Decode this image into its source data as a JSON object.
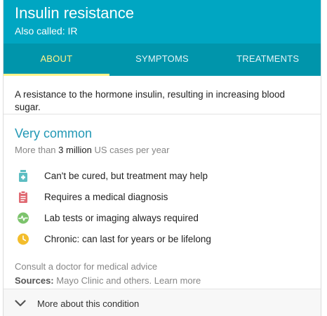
{
  "header": {
    "title": "Insulin resistance",
    "also_called": "Also called: IR"
  },
  "tabs": [
    {
      "label": "ABOUT",
      "active": true
    },
    {
      "label": "SYMPTOMS",
      "active": false
    },
    {
      "label": "TREATMENTS",
      "active": false
    }
  ],
  "description": "A resistance to the hormone insulin, resulting in increasing blood sugar.",
  "prevalence": {
    "heading": "Very common",
    "cases_prefix": "More than",
    "cases_count": "3 million",
    "cases_suffix": "US cases per year"
  },
  "facts": [
    {
      "icon": "medicine-bottle-icon",
      "color": "#5dbdc2",
      "text": "Can't be cured, but treatment may help"
    },
    {
      "icon": "clipboard-icon",
      "color": "#e06a73",
      "text": "Requires a medical diagnosis"
    },
    {
      "icon": "heartbeat-icon",
      "color": "#7cc36c",
      "text": "Lab tests or imaging always required"
    },
    {
      "icon": "clock-icon",
      "color": "#f3bd2c",
      "text": "Chronic: can last for years or be lifelong"
    }
  ],
  "consult": "Consult a doctor for medical advice",
  "sources": {
    "label": "Sources:",
    "text": "Mayo Clinic and others.",
    "link": "Learn more"
  },
  "more": {
    "label": "More about this condition"
  },
  "colors": {
    "header_bg": "#00a6c2",
    "tabs_bg": "#0095ab",
    "active_tab": "#fff48a",
    "heading": "#2298b5"
  }
}
